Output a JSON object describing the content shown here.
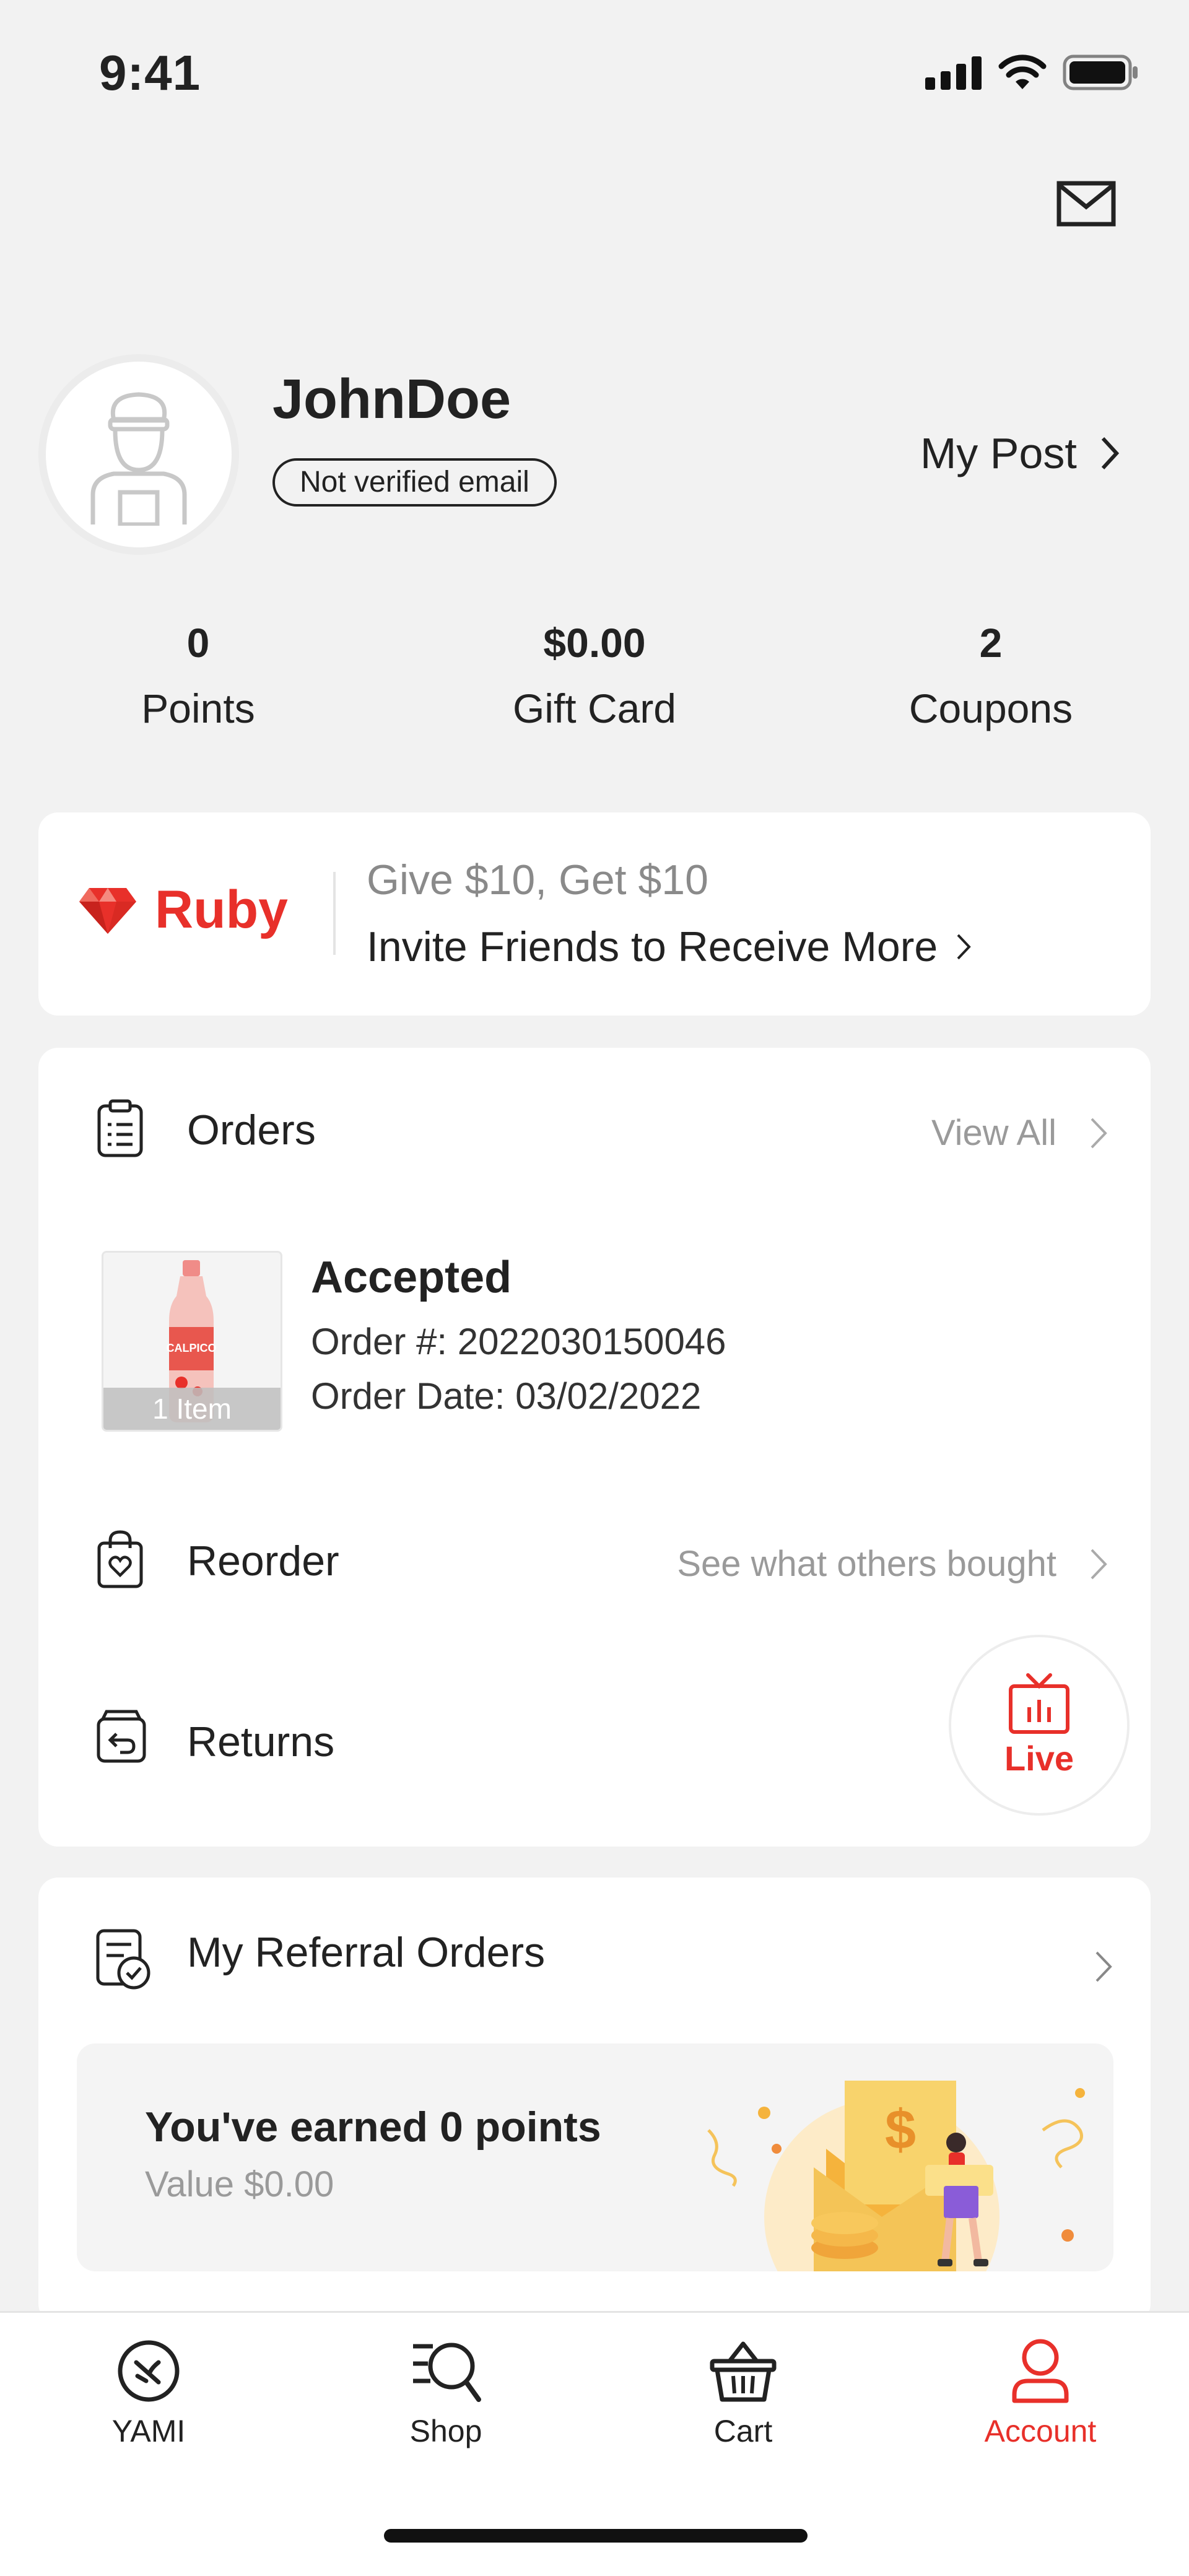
{
  "status_bar": {
    "time": "9:41"
  },
  "profile": {
    "username": "JohnDoe",
    "email_badge": "Not verified email",
    "my_post_label": "My Post"
  },
  "stats": [
    {
      "value": "0",
      "label": "Points"
    },
    {
      "value": "$0.00",
      "label": "Gift Card"
    },
    {
      "value": "2",
      "label": "Coupons"
    }
  ],
  "ruby": {
    "tier": "Ruby",
    "promo_line1": "Give $10, Get $10",
    "promo_line2": "Invite Friends to Receive More"
  },
  "orders": {
    "title": "Orders",
    "view_all": "View All",
    "latest": {
      "status": "Accepted",
      "order_number": "Order #: 2022030150046",
      "order_date": "Order Date: 03/02/2022",
      "item_count": "1 Item"
    },
    "reorder_label": "Reorder",
    "reorder_hint": "See what others bought",
    "returns_label": "Returns",
    "live_label": "Live"
  },
  "referral": {
    "title": "My Referral Orders",
    "earned": "You've earned 0 points",
    "value": "Value $0.00"
  },
  "nav": [
    {
      "label": "YAMI",
      "icon": "yami-icon",
      "active": false
    },
    {
      "label": "Shop",
      "icon": "shop-search-icon",
      "active": false
    },
    {
      "label": "Cart",
      "icon": "cart-basket-icon",
      "active": false
    },
    {
      "label": "Account",
      "icon": "account-user-icon",
      "active": true
    }
  ],
  "colors": {
    "accent": "#e8302a",
    "background": "#f2f2f2",
    "card": "#ffffff",
    "muted": "#9a9a9a"
  }
}
